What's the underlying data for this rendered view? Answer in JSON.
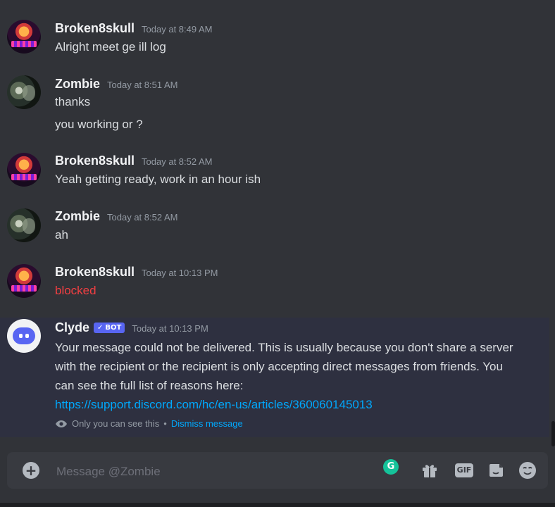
{
  "messages": [
    {
      "username": "Broken8skull",
      "time": "Today at 8:49 AM",
      "lines": [
        "Alright meet ge ill log"
      ]
    },
    {
      "username": "Zombie",
      "time": "Today at 8:51 AM",
      "lines": [
        "thanks",
        "you working or ?"
      ]
    },
    {
      "username": "Broken8skull",
      "time": "Today at 8:52 AM",
      "lines": [
        "Yeah getting ready, work in an hour ish"
      ]
    },
    {
      "username": "Zombie",
      "time": "Today at 8:52 AM",
      "lines": [
        "ah"
      ]
    },
    {
      "username": "Broken8skull",
      "time": "Today at 10:13 PM",
      "lines": [
        "blocked"
      ]
    }
  ],
  "clyde": {
    "username": "Clyde",
    "badge": "BOT",
    "badge_check": "✓",
    "time": "Today at 10:13 PM",
    "body": "Your message could not be delivered. This is usually because you don't share a server with the recipient or the recipient is only accepting direct messages from friends. You can see the full list of reasons here:",
    "link": "https://support.discord.com/hc/en-us/articles/360060145013",
    "only_you": "Only you can see this",
    "separator": "•",
    "dismiss": "Dismiss message"
  },
  "composer": {
    "placeholder": "Message @Zombie",
    "add_icon": "plus-circle-icon",
    "tools": [
      "grammarly-icon",
      "gift-icon",
      "gif-icon",
      "sticker-icon",
      "emoji-icon"
    ],
    "gif_label": "GIF"
  },
  "colors": {
    "background": "#313338",
    "highlight": "#2e3040",
    "link": "#00a8fc",
    "blocked_text": "#f23f42",
    "bot_badge": "#5865f2"
  }
}
